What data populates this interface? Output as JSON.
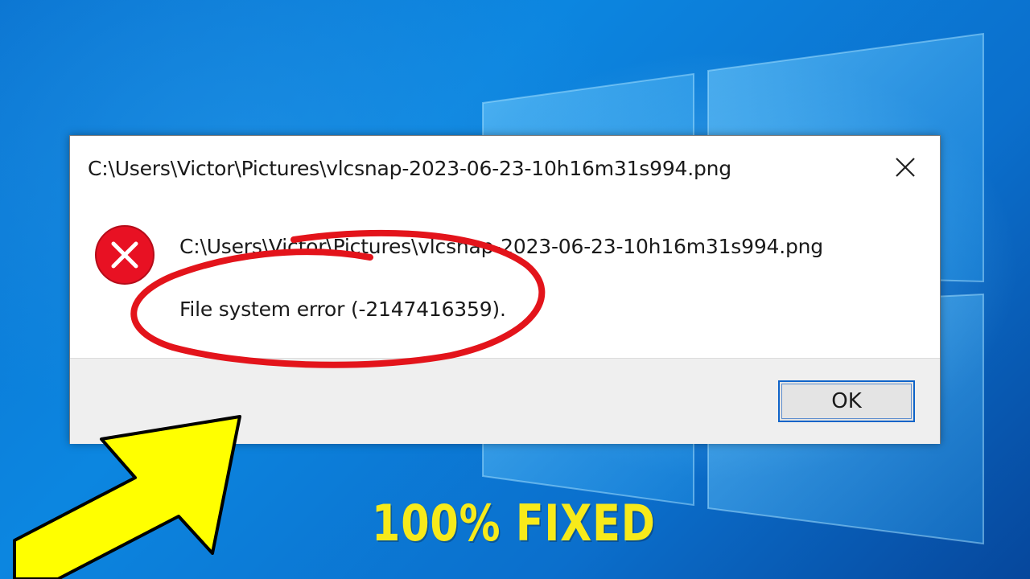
{
  "dialog": {
    "title": "C:\\Users\\Victor\\Pictures\\vlcsnap-2023-06-23-10h16m31s994.png",
    "message_path": "C:\\Users\\Victor\\Pictures\\vlcsnap-2023-06-23-10h16m31s994.png",
    "message_error": "File system error (-2147416359).",
    "ok_label": "OK",
    "close_icon": "close-icon",
    "status_icon": "error-icon"
  },
  "overlay": {
    "caption": "100% FIXED",
    "highlight_color": "#e3141b",
    "arrow_color": "#ffff00",
    "caption_color": "#f7ea1a"
  },
  "desktop": {
    "background_color": "#0b7ad6",
    "logo": "windows-logo"
  }
}
